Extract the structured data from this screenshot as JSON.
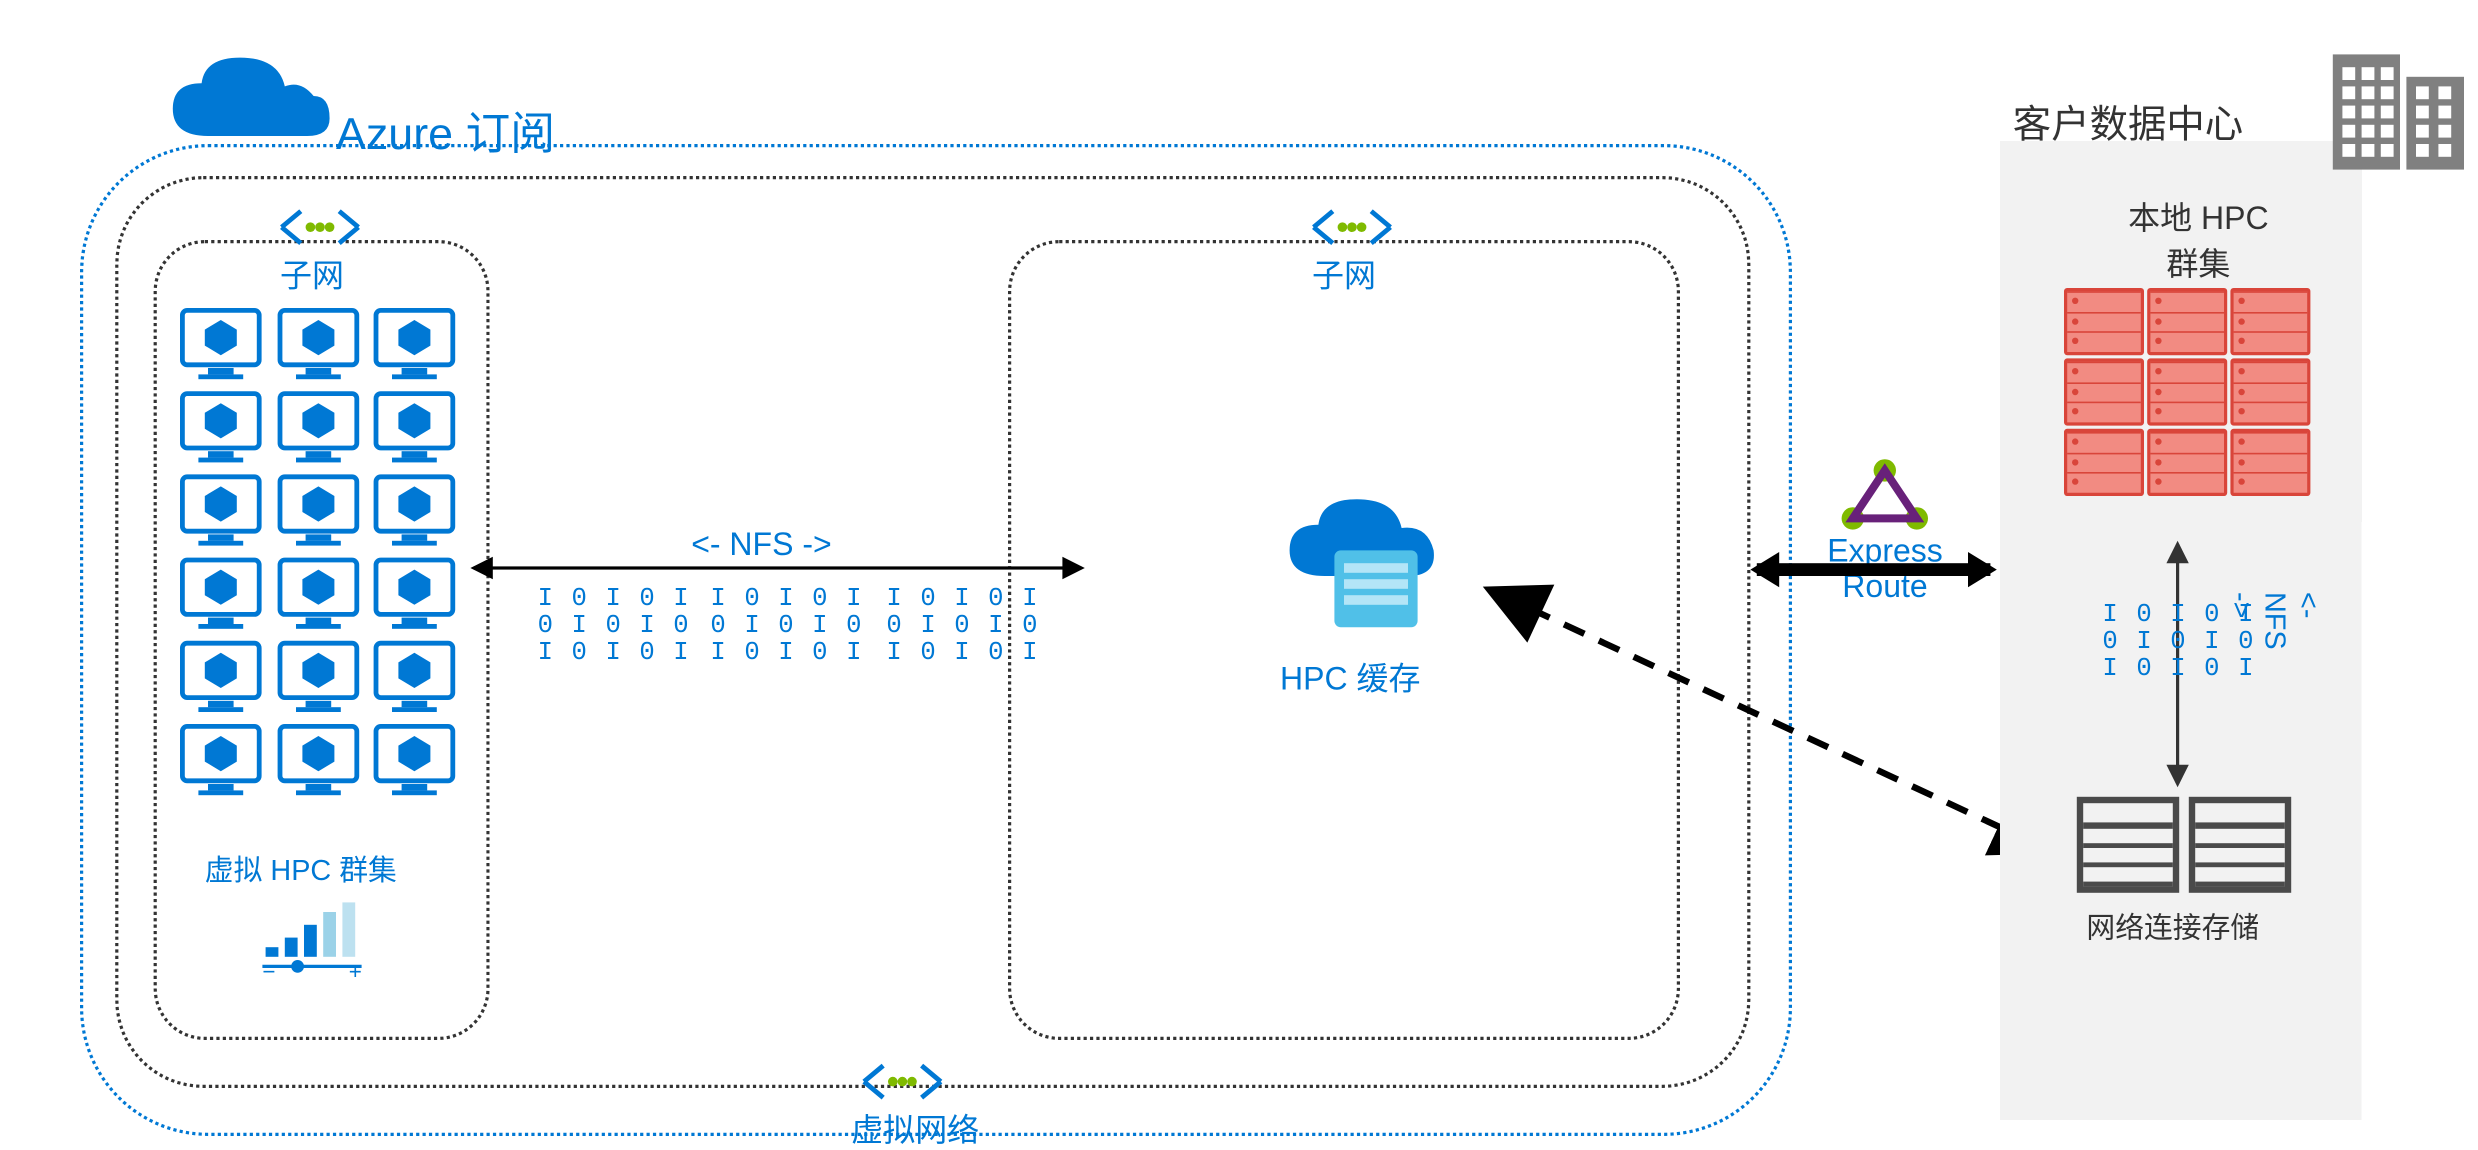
{
  "azure": {
    "subscription_label": "Azure 订阅",
    "vnet_label": "虚拟网络",
    "subnet_label": "子网",
    "virtual_hpc_label": "虚拟 HPC 群集",
    "hpc_cache_label": "HPC 缓存",
    "nfs_arrow_label": "<- NFS ->",
    "binary_block": "I 0 I 0 I\n0 I 0 I 0\nI 0 I 0 I"
  },
  "connection": {
    "express_route_label": "Express\nRoute"
  },
  "datacenter": {
    "title": "客户数据中心",
    "onprem_hpc_label": "本地 HPC\n群集",
    "nfs_vertical_label": "<- NFS ->",
    "nas_label": "网络连接存储"
  },
  "colors": {
    "azure_blue": "#0078d4",
    "rack_fill": "#f28b82",
    "rack_border": "#d9453a",
    "express_green": "#7fba00",
    "express_purple": "#68217a",
    "nas_gray": "#4a4a4a"
  }
}
